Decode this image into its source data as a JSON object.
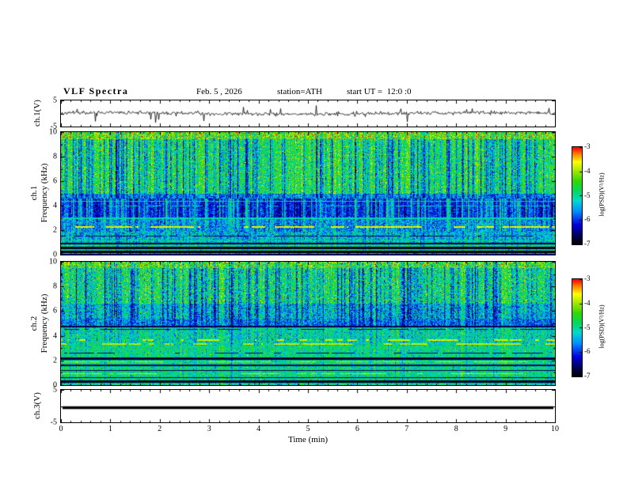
{
  "header": {
    "title": "VLF Spectra",
    "date": "Feb. 5 , 2026",
    "station": "station=ATH",
    "start_ut": "start UT =  12:0 :0"
  },
  "xaxis": {
    "label": "Time (min)",
    "min": 0,
    "max": 10,
    "major_ticks": [
      0,
      1,
      2,
      3,
      4,
      5,
      6,
      7,
      8,
      9,
      10
    ],
    "minor_step": 0.2
  },
  "colorbar": {
    "label": "log(PSD)(V²/Hz)",
    "min": -7,
    "max": -3,
    "ticks": [
      -3,
      -4,
      -5,
      -6,
      -7
    ],
    "colormap": [
      [
        0,
        "#000000"
      ],
      [
        0.08,
        "#000050"
      ],
      [
        0.2,
        "#0000e0"
      ],
      [
        0.34,
        "#0090ff"
      ],
      [
        0.45,
        "#00d8d0"
      ],
      [
        0.55,
        "#00d860"
      ],
      [
        0.65,
        "#30d800"
      ],
      [
        0.76,
        "#a8e800"
      ],
      [
        0.85,
        "#ffff00"
      ],
      [
        0.93,
        "#ff8000"
      ],
      [
        1,
        "#ff0000"
      ]
    ]
  },
  "chart_data": [
    {
      "type": "line",
      "panel": "ch1-waveform",
      "ylabel": "ch.1(V)",
      "ylim": [
        -5,
        5
      ],
      "ytick_labels": [
        5,
        -5
      ],
      "ytick_marks": [
        5,
        0,
        -5
      ],
      "signal": {
        "seed": 11,
        "noise_sd": 0.32,
        "spike_prob": 0.06,
        "spike_max": 3.2,
        "drift_amp": 0.3
      }
    },
    {
      "type": "heatmap",
      "panel": "ch1-spectrogram",
      "ylabel_lines": [
        "ch.1",
        "Frequency (kHz)"
      ],
      "ylim": [
        0,
        10
      ],
      "ytick_labels": [
        0,
        2,
        4,
        6,
        8,
        10
      ],
      "ytick_marks": [
        0,
        2,
        4,
        6,
        8,
        10
      ],
      "seed": 21,
      "event_prob": 0.32,
      "column_jitter": 0.2,
      "bands": [
        {
          "fmin": 9.4,
          "fmax": 10.01,
          "base": -4.15,
          "noise": 0.55,
          "stripe": -0.9,
          "speck_prob": 0.04,
          "speck_value": -3.3
        },
        {
          "fmin": 5.0,
          "fmax": 9.4,
          "base": -4.55,
          "noise": 0.45,
          "stripe": -1.7,
          "speck_prob": 0.012,
          "speck_value": -3.5
        },
        {
          "fmin": 4.6,
          "fmax": 5.0,
          "base": -5.5,
          "noise": 0.4,
          "stripe": -0.8
        },
        {
          "fmin": 2.9,
          "fmax": 4.6,
          "base": -6.3,
          "noise": 0.3,
          "stripe": 1.4
        },
        {
          "fmin": 1.9,
          "fmax": 2.9,
          "base": -5.75,
          "noise": 0.4,
          "stripe": 0.7
        },
        {
          "fmin": 1.0,
          "fmax": 1.9,
          "base": -5.3,
          "noise": 0.4,
          "stripe": -0.3
        },
        {
          "fmin": 0.35,
          "fmax": 1.0,
          "base": -5.0,
          "noise": 0.35,
          "stripe": -0.25
        },
        {
          "fmin": 0,
          "fmax": 0.35,
          "base": -5.3,
          "noise": 0.45,
          "stripe": 0
        }
      ],
      "lines": [
        {
          "f": 4.35,
          "hw": 0.05,
          "value": -5.0,
          "dash": false
        },
        {
          "f": 3.95,
          "hw": 0.04,
          "value": -5.2,
          "dash": true
        },
        {
          "f": 2.95,
          "hw": 0.05,
          "value": -5.1,
          "dash": false
        },
        {
          "f": 2.25,
          "hw": 0.05,
          "value": -3.7,
          "dash": true
        },
        {
          "f": 1.5,
          "hw": 0.04,
          "value": -6.6,
          "dash": true
        },
        {
          "f": 1.15,
          "hw": 0.04,
          "value": -5.0,
          "dash": false
        },
        {
          "f": 0.9,
          "hw": 0.05,
          "value": -6.8,
          "dash": false
        },
        {
          "f": 0.55,
          "hw": 0.07,
          "value": -6.9,
          "dash": false
        },
        {
          "f": 0.25,
          "hw": 0.09,
          "value": -7.0,
          "dash": false
        },
        {
          "f": 0.03,
          "hw": 0.06,
          "value": -6.5,
          "dash": false
        }
      ]
    },
    {
      "type": "heatmap",
      "panel": "ch2-spectrogram",
      "ylabel_lines": [
        "ch.2",
        "Frequency (kHz)"
      ],
      "ylim": [
        0,
        10
      ],
      "ytick_labels": [
        0,
        2,
        4,
        6,
        8,
        10
      ],
      "ytick_marks": [
        0,
        2,
        4,
        6,
        8,
        10
      ],
      "seed": 37,
      "event_prob": 0.3,
      "column_jitter": 0.2,
      "bands": [
        {
          "fmin": 9.5,
          "fmax": 10.01,
          "base": -4.3,
          "noise": 0.6,
          "stripe": -1.0,
          "speck_prob": 0.03,
          "speck_value": -3.3
        },
        {
          "fmin": 6.6,
          "fmax": 9.5,
          "base": -4.7,
          "noise": 0.5,
          "stripe": -1.6,
          "speck_prob": 0.01,
          "speck_value": -3.5
        },
        {
          "fmin": 5.4,
          "fmax": 6.6,
          "base": -5.2,
          "noise": 0.45,
          "stripe": -1.3
        },
        {
          "fmin": 4.8,
          "fmax": 5.4,
          "base": -5.6,
          "noise": 0.4,
          "stripe": -0.6
        },
        {
          "fmin": 3.2,
          "fmax": 4.8,
          "base": -5.0,
          "noise": 0.4,
          "stripe": -0.4
        },
        {
          "fmin": 0.45,
          "fmax": 3.2,
          "base": -4.9,
          "noise": 0.35,
          "stripe": -0.25
        },
        {
          "fmin": 0,
          "fmax": 0.45,
          "base": -5.1,
          "noise": 0.4,
          "stripe": 0
        }
      ],
      "lines": [
        {
          "f": 4.75,
          "hw": 0.05,
          "value": -6.7,
          "dash": false
        },
        {
          "f": 4.5,
          "hw": 0.04,
          "value": -6.5,
          "dash": true
        },
        {
          "f": 3.65,
          "hw": 0.05,
          "value": -3.8,
          "dash": true
        },
        {
          "f": 3.35,
          "hw": 0.05,
          "value": -3.9,
          "dash": true
        },
        {
          "f": 3.05,
          "hw": 0.04,
          "value": -4.6,
          "dash": false
        },
        {
          "f": 2.6,
          "hw": 0.04,
          "value": -6.5,
          "dash": true
        },
        {
          "f": 2.15,
          "hw": 0.07,
          "value": -6.8,
          "dash": false
        },
        {
          "f": 1.9,
          "hw": 0.04,
          "value": -3.9,
          "dash": true
        },
        {
          "f": 1.6,
          "hw": 0.04,
          "value": -6.6,
          "dash": false
        },
        {
          "f": 1.2,
          "hw": 0.05,
          "value": -6.7,
          "dash": false
        },
        {
          "f": 0.95,
          "hw": 0.04,
          "value": -3.9,
          "dash": true
        },
        {
          "f": 0.6,
          "hw": 0.05,
          "value": -6.8,
          "dash": false
        },
        {
          "f": 0.3,
          "hw": 0.08,
          "value": -6.9,
          "dash": false
        }
      ]
    },
    {
      "type": "line",
      "panel": "ch3-waveform",
      "ylabel": "ch.3(V)",
      "ylim": [
        -5,
        5
      ],
      "ytick_labels": [
        5,
        -5
      ],
      "ytick_marks": [
        5,
        0,
        -5
      ],
      "signal": {
        "constant": -0.5,
        "linewidth": 3.5
      }
    }
  ]
}
